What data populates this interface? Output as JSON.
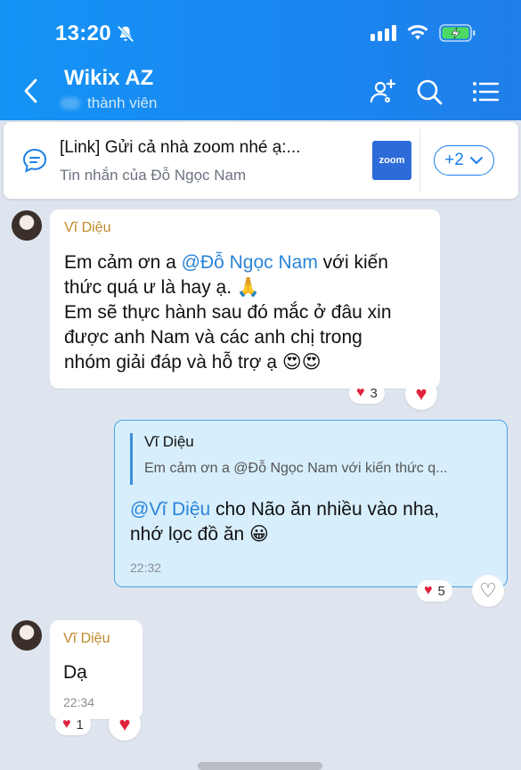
{
  "status_bar": {
    "time": "13:20"
  },
  "header": {
    "title": "Wikix AZ",
    "subtitle": "thành viên"
  },
  "pinned": {
    "title": "[Link] Gửi cả nhà zoom nhé ạ:...",
    "subtitle": "Tin nhắn của Đỗ Ngọc Nam",
    "thumb_label": "zoom",
    "more_label": "+2"
  },
  "messages": [
    {
      "sender": "Vĩ Diệu",
      "line1_pre": "Em cảm ơn a ",
      "line1_mention": "@Đỗ Ngọc Nam",
      "line1_post": " với kiến",
      "line2": "thức quá ư là hay ạ. 🙏",
      "line3": "Em sẽ thực hành sau đó mắc ở đâu xin",
      "line4": "được anh Nam và các anh chị trong",
      "line5": "nhóm giải đáp và hỗ trợ ạ 😍😍",
      "reaction_count": "3"
    },
    {
      "quote_name": "Vĩ Diệu",
      "quote_text": "Em cảm ơn a @Đỗ Ngọc Nam với kiến thức q...",
      "mention": "@Vĩ Diệu",
      "line1_post": " cho Não ăn nhiều vào nha,",
      "line2": "nhớ lọc đồ ăn 😀",
      "time": "22:32",
      "reaction_count": "5"
    },
    {
      "sender": "Vĩ Diệu",
      "text": "Dạ",
      "time": "22:34",
      "reaction_count": "1"
    }
  ],
  "colors": {
    "header": "#1a86f0",
    "accent": "#1a7fe8",
    "heart": "#e0213c",
    "sender": "#c08a2a"
  }
}
